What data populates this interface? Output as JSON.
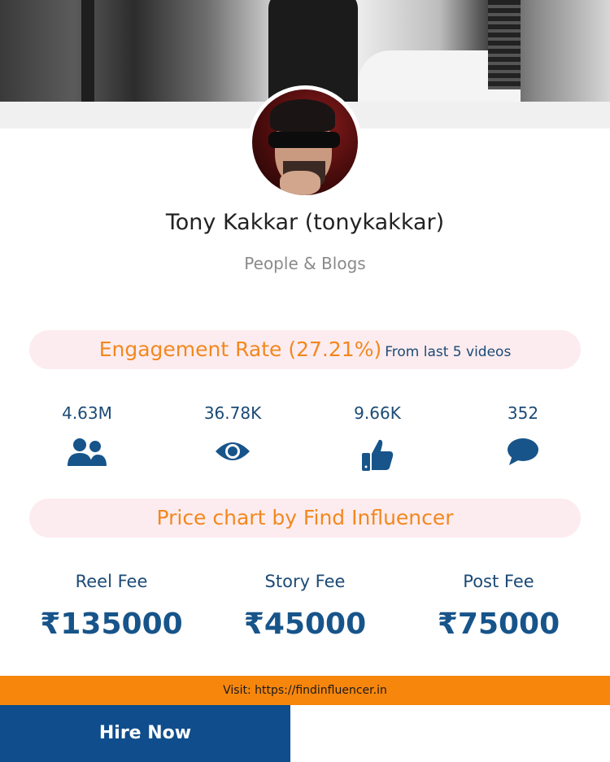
{
  "profile": {
    "name": "Tony Kakkar (tonykakkar)",
    "category": "People & Blogs"
  },
  "engagement": {
    "label": "Engagement Rate (27.21%)",
    "note": "From last 5 videos"
  },
  "stats": [
    {
      "value": "4.63M",
      "icon": "users-icon"
    },
    {
      "value": "36.78K",
      "icon": "eye-icon"
    },
    {
      "value": "9.66K",
      "icon": "thumbs-up-icon"
    },
    {
      "value": "352",
      "icon": "comment-icon"
    }
  ],
  "price_chart": {
    "title": "Price chart by Find Influencer",
    "fees": [
      {
        "label": "Reel Fee",
        "amount": "₹135000"
      },
      {
        "label": "Story Fee",
        "amount": "₹45000"
      },
      {
        "label": "Post Fee",
        "amount": "₹75000"
      }
    ]
  },
  "footer": {
    "visit_text": "Visit: https://findinfluencer.in",
    "hire_label": "Hire Now"
  },
  "colors": {
    "accent_orange": "#f2881f",
    "brand_blue": "#0f4d8c",
    "pill_bg": "#fcecef"
  }
}
